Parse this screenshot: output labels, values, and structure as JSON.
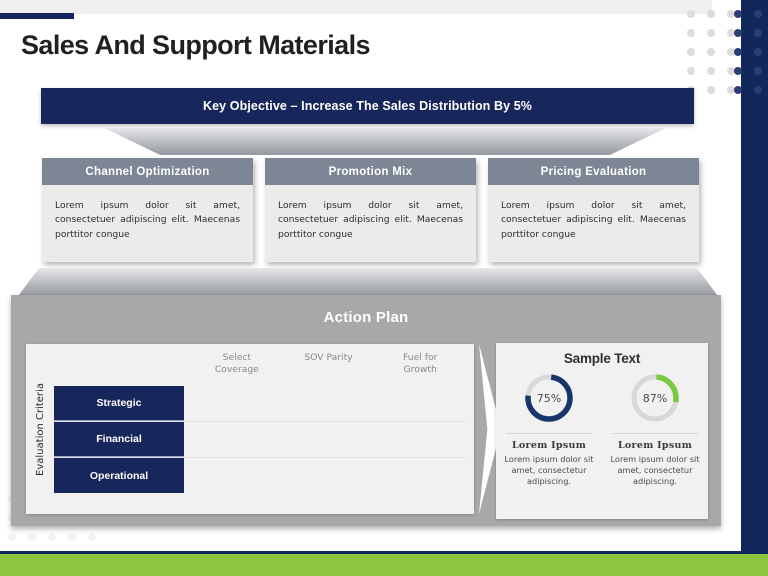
{
  "slide": {
    "title": "Sales And Support Materials",
    "objective": "Key Objective – Increase The Sales Distribution  By 5%"
  },
  "colors": {
    "navy": "#17275c",
    "navy_band": "#12275c",
    "green": "#8cc63e",
    "card_header": "#7c8694",
    "panel_gray": "#a8a8a8",
    "donut_navy": "#17366b",
    "donut_green": "#7ac943",
    "donut_track": "#d8d8d8"
  },
  "cards": [
    {
      "title": "Channel  Optimization",
      "body": "Lorem  ipsum  dolor  sit amet, consectetuer adipiscing  elit. Maecenas porttitor  congue"
    },
    {
      "title": "Promotion  Mix",
      "body": "Lorem  ipsum  dolor  sit amet, consectetuer adipiscing  elit. Maecenas porttitor  congue"
    },
    {
      "title": "Pricing  Evaluation",
      "body": "Lorem  ipsum  dolor  sit amet, consectetuer adipiscing  elit. Maecenas porttitor  congue"
    }
  ],
  "action_plan": {
    "title": "Action Plan",
    "axis_label": "Evaluation Criteria",
    "columns": [
      "Select\nCoverage",
      "SOV Parity",
      "Fuel for\nGrowth"
    ],
    "rows": [
      "Strategic",
      "Financial",
      "Operational"
    ]
  },
  "sample": {
    "title": "Sample Text",
    "donuts": [
      {
        "percent_label": "75%",
        "percent_value": 75,
        "color": "#17366b",
        "heading": "Lorem  Ipsum",
        "desc": "Lorem ipsum dolor sit amet, consectetur adipiscing."
      },
      {
        "percent_label": "87%",
        "percent_value": 27,
        "color": "#7ac943",
        "heading": "Lorem  Ipsum",
        "desc": "Lorem ipsum dolor sit amet, consectetur adipiscing."
      }
    ]
  }
}
